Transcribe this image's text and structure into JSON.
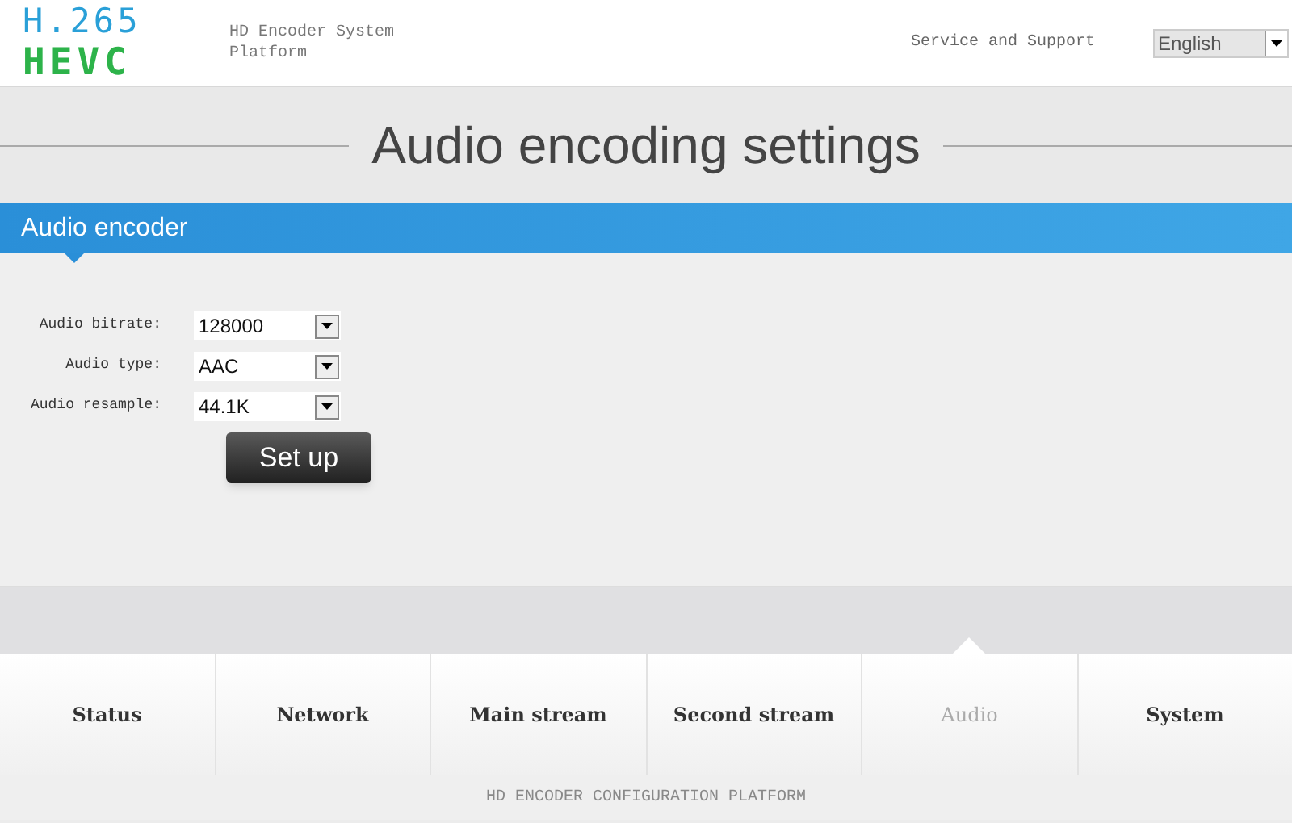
{
  "logo": {
    "line_1": "H.265",
    "line_2": "HEVC"
  },
  "header": {
    "subtitle": "HD Encoder System Platform",
    "support_link": "Service and Support",
    "language": "English"
  },
  "page_title": "Audio encoding settings",
  "section": {
    "title": "Audio encoder"
  },
  "fields": [
    {
      "label": "Audio bitrate:",
      "value": "128000"
    },
    {
      "label": "Audio type:",
      "value": "AAC"
    },
    {
      "label": "Audio resample:",
      "value": "44.1K"
    }
  ],
  "submit_button": "Set up",
  "nav": [
    {
      "label": "Status",
      "selected": false
    },
    {
      "label": "Network",
      "selected": false
    },
    {
      "label": "Main stream",
      "selected": false
    },
    {
      "label": "Second stream",
      "selected": false
    },
    {
      "label": "Audio",
      "selected": true
    },
    {
      "label": "System",
      "selected": false
    }
  ],
  "footer": "HD ENCODER CONFIGURATION PLATFORM"
}
